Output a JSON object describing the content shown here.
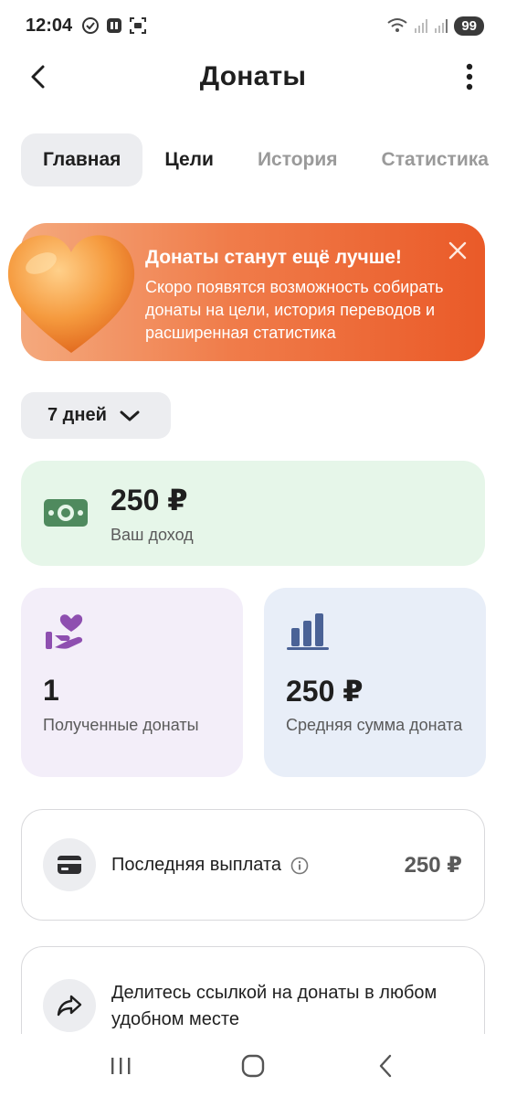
{
  "status": {
    "time": "12:04",
    "battery": "99"
  },
  "header": {
    "title": "Донаты"
  },
  "tabs": [
    {
      "label": "Главная"
    },
    {
      "label": "Цели"
    },
    {
      "label": "История"
    },
    {
      "label": "Статистика"
    }
  ],
  "promo": {
    "title": "Донаты станут ещё лучше!",
    "text": "Скоро появятся возможность собирать донаты на цели, история переводов и расширенная статистика"
  },
  "period": {
    "label": "7 дней"
  },
  "income": {
    "value": "250 ₽",
    "label": "Ваш доход"
  },
  "stats": {
    "received": {
      "value": "1",
      "label": "Полученные донаты"
    },
    "average": {
      "value": "250 ₽",
      "label": "Средняя сумма доната"
    }
  },
  "payout": {
    "label": "Последняя выплата",
    "value": "250 ₽"
  },
  "share": {
    "text": "Делитесь ссылкой на донаты в любом удобном месте"
  },
  "colors": {
    "promo_start": "#f4a97d",
    "promo_end": "#ea5a28",
    "income_bg": "#e6f6e9",
    "money_icon": "#4f8a5e",
    "received_bg": "#f3eef9",
    "received_icon": "#8e4fb0",
    "average_bg": "#e8eef8",
    "average_icon": "#4a6296"
  }
}
